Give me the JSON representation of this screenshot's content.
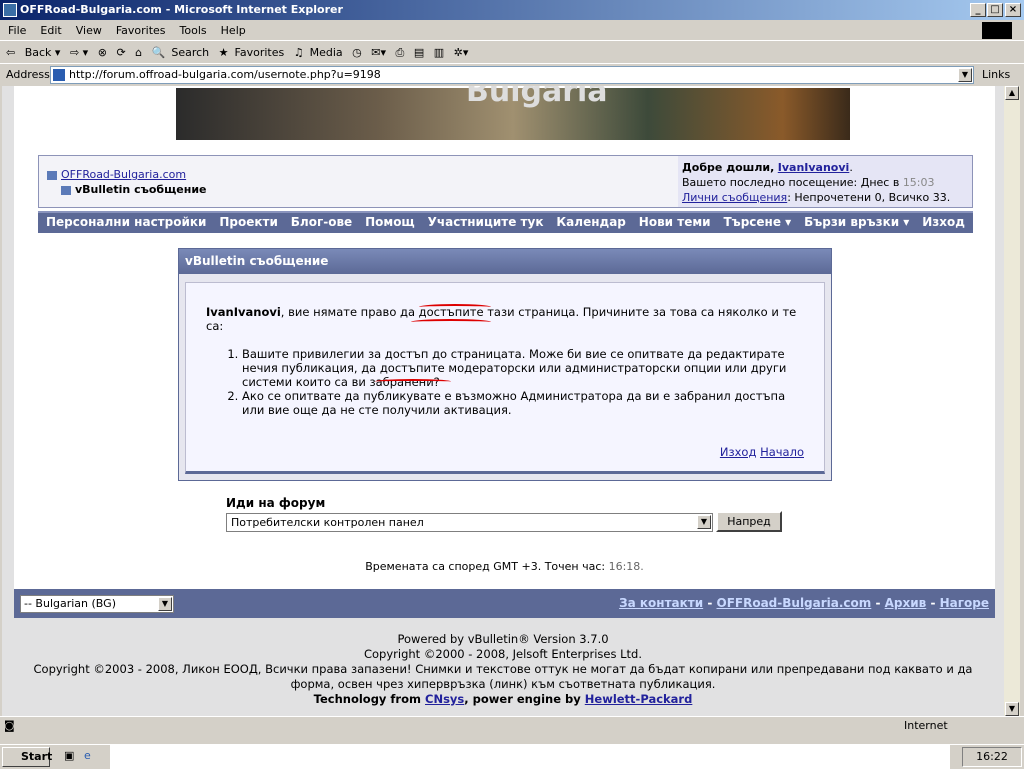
{
  "window": {
    "title": "OFFRoad-Bulgaria.com - Microsoft Internet Explorer"
  },
  "menu": [
    "File",
    "Edit",
    "View",
    "Favorites",
    "Tools",
    "Help"
  ],
  "toolbar": {
    "back": "Back",
    "search": "Search",
    "favorites": "Favorites",
    "media": "Media"
  },
  "address": {
    "label": "Address",
    "url": "http://forum.offroad-bulgaria.com/usernote.php?u=9198",
    "links": "Links"
  },
  "banner": {
    "text": "Bulgaria"
  },
  "breadcrumb": {
    "site": "OFFRoad-Bulgaria.com",
    "current": "vBulletin съобщение"
  },
  "welcome": {
    "greeting": "Добре дошли,",
    "user": "IvanIvanovi",
    "last_visit": "Вашето последно посещение: Днес в",
    "last_time": "15:03",
    "pm_link": "Лични съобщения",
    "pm_text": ": Непрочетени 0, Всичко 33."
  },
  "nav": [
    "Персонални настройки",
    "Проекти",
    "Блог-ове",
    "Помощ",
    "Участниците тук",
    "Календар",
    "Нови теми",
    "Търсене ▾",
    "Бързи връзки ▾",
    "Изход"
  ],
  "message": {
    "title": "vBulletin съобщение",
    "user": "IvanIvanovi",
    "intro": ", вие нямате право да достъпите тази страница. Причините за това са няколко и те са:",
    "reasons": [
      "Вашите привилегии за достъп до страницата. Може би вие се опитвате да редактирате нечия публикация, да достъпите модераторски или администраторски опции или други системи които са ви забранени?",
      "Ако се опитвате да публикувате е възможно Администратора да ви е забранил достъпа или вие още да не сте получили активация."
    ],
    "logout": "Изход",
    "home": "Начало"
  },
  "jump": {
    "label": "Иди на форум",
    "selected": "Потребителски контролен панел",
    "button": "Напред"
  },
  "timezone": {
    "text": "Времената са според GMT +3. Точен час:",
    "time": "16:18."
  },
  "footer": {
    "language": "-- Bulgarian (BG)",
    "links": [
      "За контакти",
      "OFFRoad-Bulgaria.com",
      "Архив",
      "Нагоре"
    ]
  },
  "copyright": {
    "l1": "Powered by vBulletin® Version 3.7.0",
    "l2": "Copyright ©2000 - 2008, Jelsoft Enterprises Ltd.",
    "l3": "Copyright ©2003 - 2008, Ликон ЕООД, Всички права запазени! Снимки и текстове оттук не могат да бъдат копирани или препредавани под каквато и да форма, освен чрез хипервръзка (линк) към съответната публикация.",
    "tech": "Technology from",
    "cnsys": "CNsys",
    "power": ", power engine by",
    "hp": "Hewlett-Packard"
  },
  "status": {
    "zone": "Internet"
  },
  "taskbar": {
    "start": "Start",
    "clock": "16:22"
  }
}
